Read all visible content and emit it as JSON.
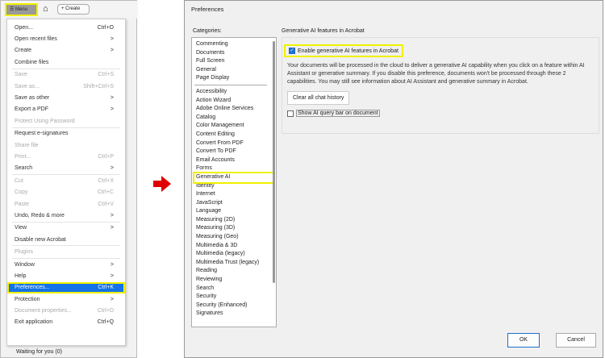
{
  "toolbar": {
    "menu": "Menu",
    "create": "Create"
  },
  "menu": [
    {
      "label": "Open...",
      "shortcut": "Ctrl+O"
    },
    {
      "label": "Open recent files",
      "shortcut": ">"
    },
    {
      "label": "Create",
      "shortcut": ">"
    },
    {
      "label": "Combine files",
      "shortcut": ""
    },
    {
      "sep": true
    },
    {
      "label": "Save",
      "shortcut": "Ctrl+S",
      "disabled": true
    },
    {
      "label": "Save as...",
      "shortcut": "Shift+Ctrl+S",
      "disabled": true
    },
    {
      "label": "Save as other",
      "shortcut": ">"
    },
    {
      "label": "Export a PDF",
      "shortcut": ">"
    },
    {
      "label": "Protect Using Password",
      "shortcut": "",
      "disabled": true
    },
    {
      "sep": true
    },
    {
      "label": "Request e-signatures",
      "shortcut": ""
    },
    {
      "label": "Share file",
      "shortcut": "",
      "disabled": true
    },
    {
      "label": "Print...",
      "shortcut": "Ctrl+P",
      "disabled": true
    },
    {
      "label": "Search",
      "shortcut": ">"
    },
    {
      "sep": true
    },
    {
      "label": "Cut",
      "shortcut": "Ctrl+X",
      "disabled": true
    },
    {
      "label": "Copy",
      "shortcut": "Ctrl+C",
      "disabled": true
    },
    {
      "label": "Paste",
      "shortcut": "Ctrl+V",
      "disabled": true
    },
    {
      "label": "Undo, Redo & more",
      "shortcut": ">"
    },
    {
      "sep": true
    },
    {
      "label": "View",
      "shortcut": ">"
    },
    {
      "label": "Disable new Acrobat",
      "shortcut": ""
    },
    {
      "sep": true
    },
    {
      "label": "Plugins",
      "shortcut": "",
      "disabled": true
    },
    {
      "sep": true
    },
    {
      "label": "Window",
      "shortcut": ">"
    },
    {
      "label": "Help",
      "shortcut": ">"
    },
    {
      "label": "Preferences...",
      "shortcut": "Ctrl+K",
      "selected": true
    },
    {
      "label": "Protection",
      "shortcut": ">"
    },
    {
      "label": "Document properties...",
      "shortcut": "Ctrl+D",
      "disabled": true
    },
    {
      "label": "Exit application",
      "shortcut": "Ctrl+Q"
    }
  ],
  "waiting": "Waiting for you (0)",
  "dialog": {
    "title": "Preferences",
    "categories_label": "Categories:",
    "categories_top": [
      "Commenting",
      "Documents",
      "Full Screen",
      "General",
      "Page Display"
    ],
    "categories": [
      "Accessibility",
      "Action Wizard",
      "Adobe Online Services",
      "Catalog",
      "Color Management",
      "Content Editing",
      "Convert From PDF",
      "Convert To PDF",
      "Email Accounts",
      "Forms",
      "Generative AI",
      "Identity",
      "Internet",
      "JavaScript",
      "Language",
      "Measuring (2D)",
      "Measuring (3D)",
      "Measuring (Geo)",
      "Multimedia & 3D",
      "Multimedia (legacy)",
      "Multimedia Trust (legacy)",
      "Reading",
      "Reviewing",
      "Search",
      "Security",
      "Security (Enhanced)",
      "Signatures"
    ],
    "selected_category": "Generative AI",
    "group_label": "Generative AI features in Acrobat",
    "enable_label": "Enable generative AI features in Acrobat",
    "enable_checked": true,
    "description": "Your documents will be processed in the cloud to deliver a generative AI capability when you click on a feature within AI Assistant or generative summary. If you disable this preference, documents won't be processed through these 2 capabilities. You may still see information about AI Assistant and generative summary in Acrobat.",
    "clear_button": "Clear all chat history",
    "query_label": "Show AI query bar on document",
    "query_checked": false,
    "ok": "OK",
    "cancel": "Cancel"
  },
  "colors": {
    "highlight": "#f0f000",
    "accent": "#1473e6",
    "arrow": "#e00000"
  }
}
